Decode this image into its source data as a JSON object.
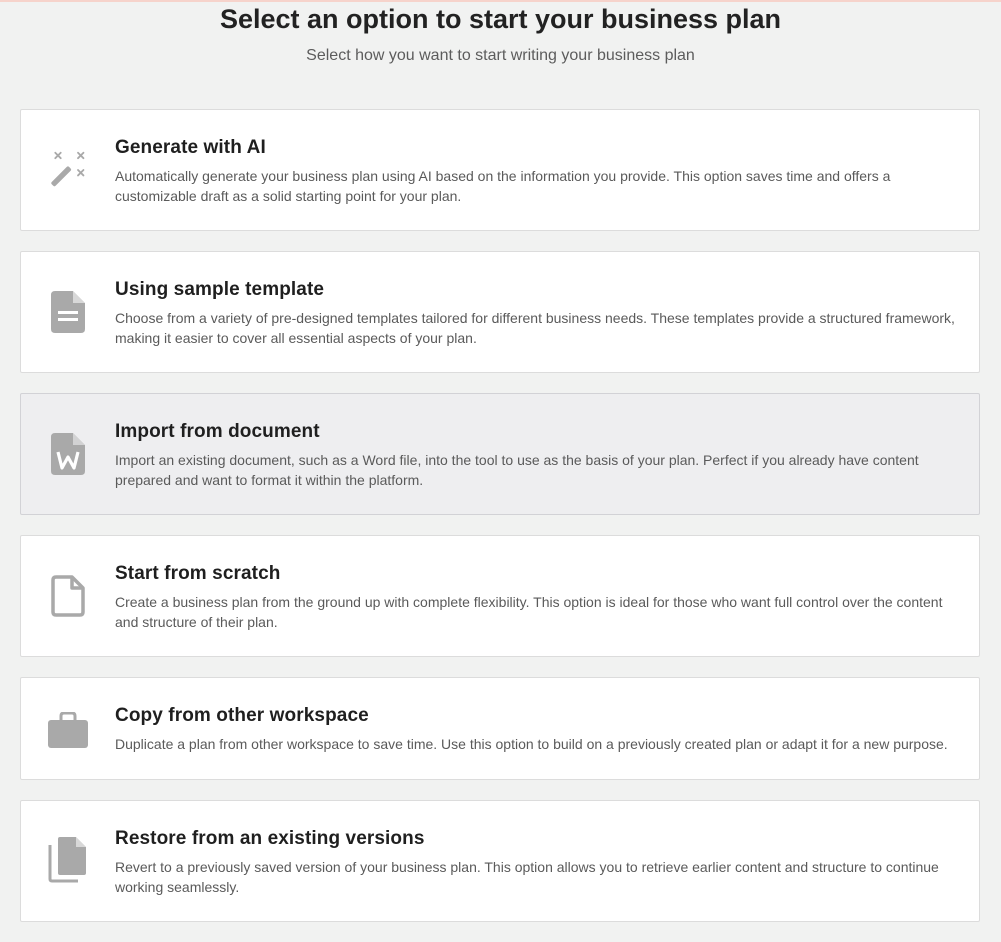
{
  "header": {
    "title": "Select an option to start your business plan",
    "subtitle": "Select how you want to start writing your business plan"
  },
  "options": [
    {
      "title": "Generate with AI",
      "description": "Automatically generate your business plan using AI based on the information you provide. This option saves time and offers a customizable draft as a solid starting point for your plan.",
      "icon": "magic-wand-icon"
    },
    {
      "title": "Using sample template",
      "description": "Choose from a variety of pre-designed templates tailored for different business needs. These templates provide a structured framework, making it easier to cover all essential aspects of your plan.",
      "icon": "document-icon"
    },
    {
      "title": "Import from document",
      "description": "Import an existing document, such as a Word file, into the tool to use as the basis of your plan. Perfect if you already have content prepared and want to format it within the platform.",
      "icon": "word-file-icon"
    },
    {
      "title": "Start from scratch",
      "description": "Create a business plan from the ground up with complete flexibility. This option is ideal for those who want full control over the content and structure of their plan.",
      "icon": "blank-file-icon"
    },
    {
      "title": "Copy from other workspace",
      "description": "Duplicate a plan from other workspace to save time. Use this option to build on a previously created plan or adapt it for a new purpose.",
      "icon": "briefcase-icon"
    },
    {
      "title": "Restore from an existing versions",
      "description": "Revert to a previously saved version of your business plan. This option allows you to retrieve earlier content and structure to continue working seamlessly.",
      "icon": "copy-files-icon"
    }
  ],
  "colors": {
    "background": "#f1f2f1",
    "card": "#ffffff",
    "card_hover": "#eeeef0",
    "icon": "#a9a9a9",
    "title_text": "#222222"
  }
}
